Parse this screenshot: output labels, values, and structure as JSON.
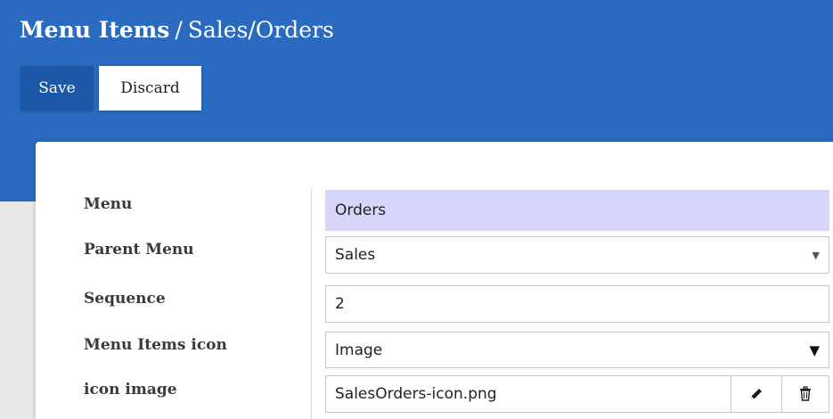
{
  "breadcrumb": {
    "root": "Menu Items",
    "separator": "/",
    "current": "Sales/Orders"
  },
  "toolbar": {
    "save_label": "Save",
    "discard_label": "Discard"
  },
  "form": {
    "menu": {
      "label": "Menu",
      "value": "Orders"
    },
    "parent_menu": {
      "label": "Parent Menu",
      "value": "Sales"
    },
    "sequence": {
      "label": "Sequence",
      "value": "2"
    },
    "menu_items_icon": {
      "label": "Menu Items icon",
      "value": "Image"
    },
    "icon_image": {
      "label": "icon image",
      "value": "SalesOrders-icon.png"
    }
  },
  "icons": {
    "parent_caret": "caret-down-icon",
    "icon_type_caret": "triangle-down-icon",
    "edit": "pencil-icon",
    "delete": "trash-icon"
  },
  "colors": {
    "header_bg": "#2a6ac1",
    "save_bg": "#1d58a8",
    "menu_field_bg": "#d6d6fb"
  }
}
